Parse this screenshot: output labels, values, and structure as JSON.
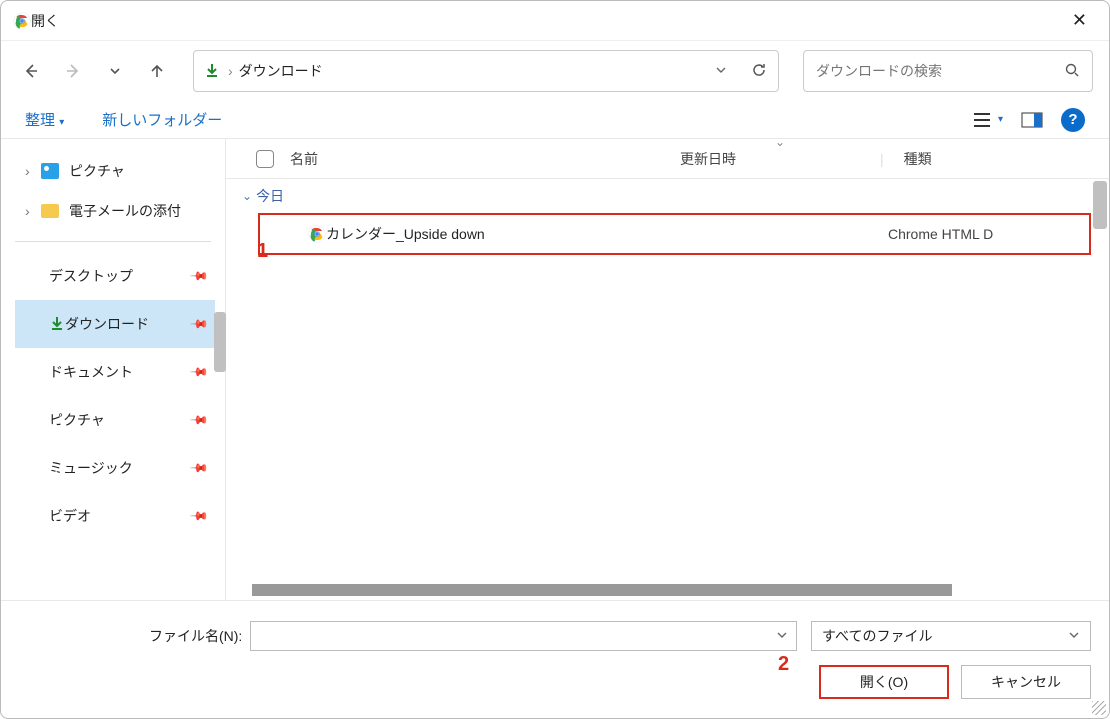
{
  "window": {
    "title": "開く"
  },
  "path": {
    "location": "ダウンロード"
  },
  "search": {
    "placeholder": "ダウンロードの検索"
  },
  "toolbar": {
    "organize": "整理",
    "newFolder": "新しいフォルダー"
  },
  "sidebar": {
    "top": [
      {
        "label": "ピクチャ"
      },
      {
        "label": "電子メールの添付"
      }
    ],
    "quick": [
      {
        "label": "デスクトップ"
      },
      {
        "label": "ダウンロード"
      },
      {
        "label": "ドキュメント"
      },
      {
        "label": "ピクチャ"
      },
      {
        "label": "ミュージック"
      },
      {
        "label": "ビデオ"
      }
    ]
  },
  "columns": {
    "name": "名前",
    "date": "更新日時",
    "type": "種類"
  },
  "group": {
    "today": "今日"
  },
  "files": [
    {
      "name": "カレンダー_Upside down",
      "date": "",
      "type": "Chrome HTML D"
    }
  ],
  "footer": {
    "filenameLabel": "ファイル名(N):",
    "filter": "すべてのファイル",
    "open": "開く(O)",
    "cancel": "キャンセル"
  },
  "annotations": {
    "a1": "1",
    "a2": "2"
  }
}
